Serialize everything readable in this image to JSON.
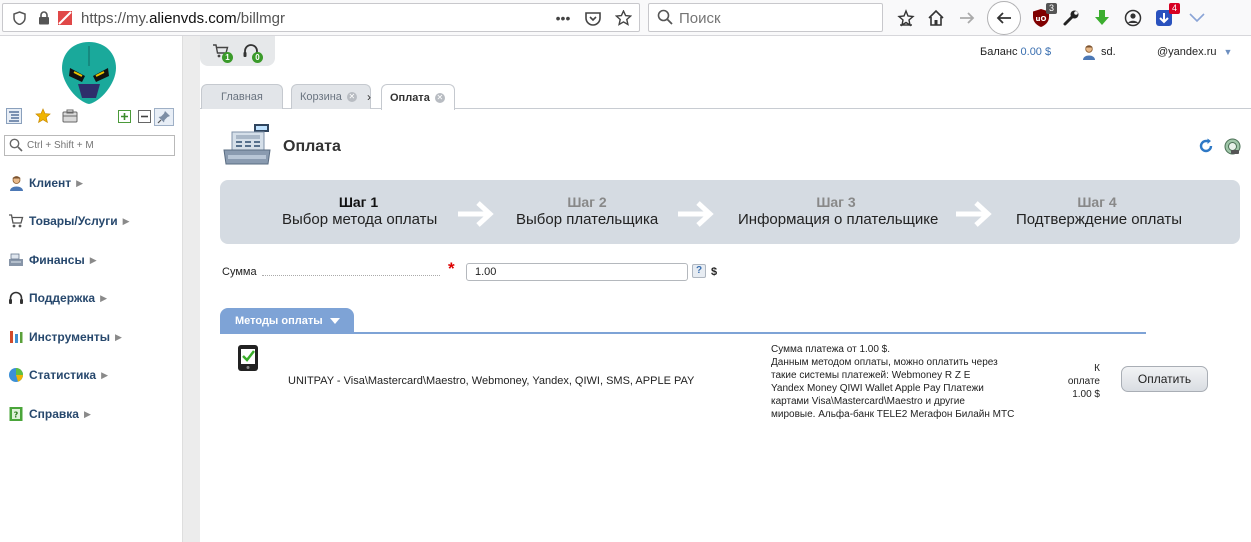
{
  "browser": {
    "url_prefix": "https://my.",
    "url_host": "alienvds.com",
    "url_path": "/billmgr",
    "search_placeholder": "Поиск",
    "ublock_badge": "3",
    "addon_badge": "4"
  },
  "sidebar": {
    "search_placeholder": "Ctrl + Shift + M",
    "items": [
      {
        "label": "Клиент",
        "icon": "user-icon"
      },
      {
        "label": "Товары/Услуги",
        "icon": "cart-icon"
      },
      {
        "label": "Финансы",
        "icon": "cash-register-icon"
      },
      {
        "label": "Поддержка",
        "icon": "headset-icon"
      },
      {
        "label": "Инструменты",
        "icon": "tools-icon"
      },
      {
        "label": "Статистика",
        "icon": "pie-chart-icon"
      },
      {
        "label": "Справка",
        "icon": "help-book-icon"
      }
    ]
  },
  "header": {
    "cart_count": "1",
    "support_count": "0",
    "balance_label": "Баланс",
    "balance_value": "0.00 $",
    "user_name": "sd.",
    "email": "@yandex.ru"
  },
  "tabs": [
    {
      "label": "Главная"
    },
    {
      "label": "Корзина"
    },
    {
      "label": "Оплата"
    }
  ],
  "page": {
    "title": "Оплата"
  },
  "steps": [
    {
      "number": "Шаг 1",
      "label": "Выбор метода оплаты",
      "active": true
    },
    {
      "number": "Шаг 2",
      "label": "Выбор плательщика",
      "active": false
    },
    {
      "number": "Шаг 3",
      "label": "Информация о плательщике",
      "active": false
    },
    {
      "number": "Шаг 4",
      "label": "Подтверждение оплаты",
      "active": false
    }
  ],
  "form": {
    "amount_label": "Сумма",
    "amount_value": "1.00",
    "help": "?",
    "currency": "$"
  },
  "payment_methods": {
    "section_title": "Методы оплаты",
    "methods": [
      {
        "name": "UNITPAY - Visa\\Mastercard\\Maestro, Webmoney, Yandex, QIWI, SMS, APPLE PAY",
        "description_lines": [
          "Сумма платежа от 1.00 $.",
          "Данным методом оплаты, можно оплатить через",
          "такие системы платежей: Webmoney R Z E",
          "Yandex Money QIWI Wallet Apple Pay Платежи",
          "картами Visa\\Mastercard\\Maestro и другие",
          "мировые. Альфа-банк TELE2 Мегафон Билайн МТС"
        ],
        "amount_lines": [
          "К",
          "оплате",
          "1.00 $"
        ],
        "button_label": "Оплатить"
      }
    ]
  },
  "colors": {
    "nav_text": "#27486d",
    "accent_blue": "#7ea3d6",
    "steps_bg": "#d5dbe2",
    "required": "#dd0000"
  }
}
